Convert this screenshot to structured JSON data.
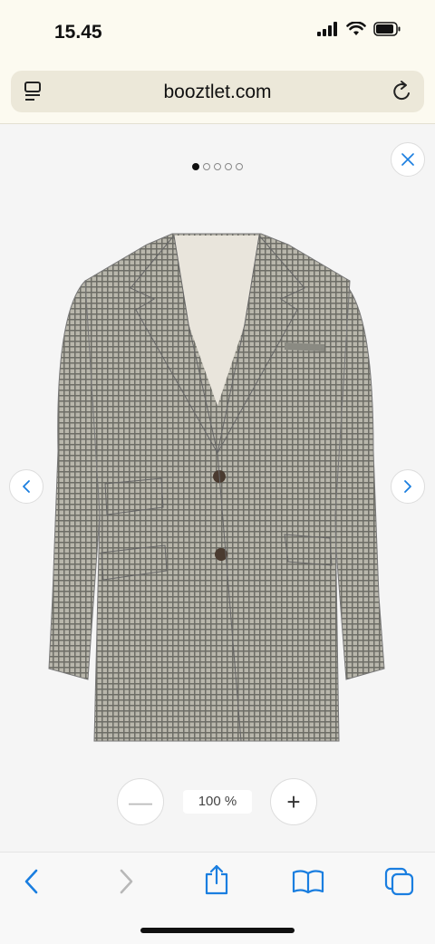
{
  "status": {
    "time": "15.45"
  },
  "browser": {
    "url": "booztlet.com"
  },
  "gallery": {
    "page_count": 5,
    "active_index": 0,
    "zoom_label": "100 %",
    "product_image": "checked-blazer-photo"
  },
  "zoom_controls": {
    "minus_symbol": "—",
    "plus_symbol": "+"
  },
  "colors": {
    "accent": "#1a7ee0",
    "background": "#f5f5f5",
    "url_bar": "#ece8d9"
  }
}
